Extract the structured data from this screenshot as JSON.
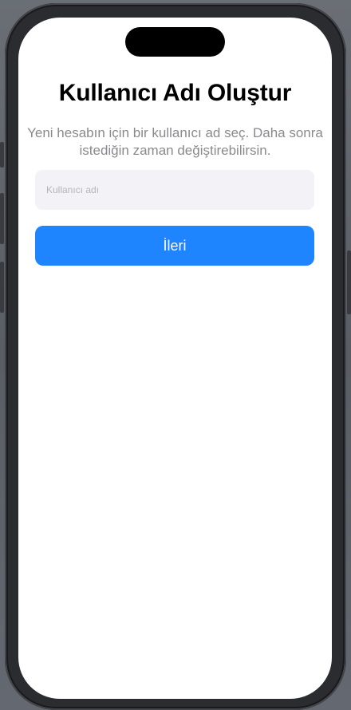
{
  "signup": {
    "title": "Kullanıcı Adı Oluştur",
    "subtitle": "Yeni hesabın için bir kullanıcı ad seç. Daha sonra istediğin zaman değiştirebilirsin.",
    "username_field": {
      "value": "",
      "placeholder": "Kullanıcı adı"
    },
    "next_label": "İleri"
  },
  "colors": {
    "accent": "#1e85ff",
    "field_background": "#f2f2f7",
    "subtitle_text": "#8a8a8e"
  }
}
